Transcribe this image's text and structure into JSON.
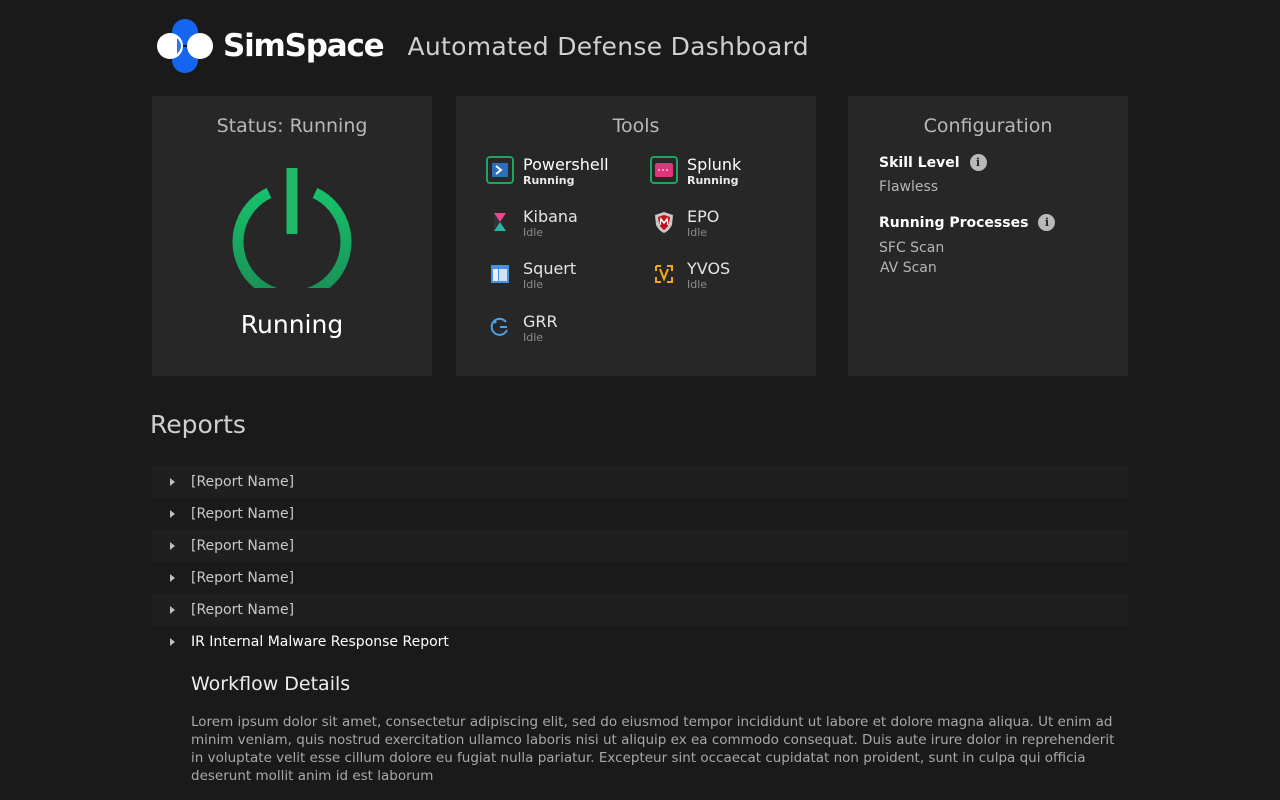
{
  "header": {
    "brand": "SimSpace",
    "title": "Automated Defense Dashboard"
  },
  "status": {
    "title": "Status: Running",
    "label": "Running",
    "color": "#1fa463"
  },
  "tools": {
    "title": "Tools",
    "items": [
      {
        "name": "Powershell",
        "state": "Running",
        "icon": "powershell-icon"
      },
      {
        "name": "Splunk",
        "state": "Running",
        "icon": "splunk-icon"
      },
      {
        "name": "Kibana",
        "state": "Idle",
        "icon": "kibana-icon"
      },
      {
        "name": "EPO",
        "state": "Idle",
        "icon": "mcafee-icon"
      },
      {
        "name": "Squert",
        "state": "Idle",
        "icon": "squert-icon"
      },
      {
        "name": "YVOS",
        "state": "Idle",
        "icon": "yvos-icon"
      },
      {
        "name": "GRR",
        "state": "Idle",
        "icon": "grr-icon"
      }
    ]
  },
  "config": {
    "title": "Configuration",
    "skill_label": "Skill Level",
    "skill_value": "Flawless",
    "processes_label": "Running Processes",
    "processes": [
      "SFC Scan",
      "AV Scan"
    ],
    "info_glyph": "i"
  },
  "reports": {
    "title": "Reports",
    "items": [
      "[Report Name]",
      "[Report Name]",
      "[Report Name]",
      "[Report Name]",
      "[Report Name]",
      "IR Internal Malware Response Report"
    ],
    "expanded": {
      "title": "Workflow Details",
      "body": "Lorem ipsum dolor sit amet, consectetur adipiscing elit, sed do eiusmod tempor incididunt ut labore et dolore magna aliqua. Ut enim ad minim veniam, quis nostrud exercitation ullamco laboris nisi ut aliquip ex ea commodo consequat. Duis aute irure dolor in reprehenderit in voluptate velit esse cillum dolore eu fugiat nulla pariatur. Excepteur sint occaecat cupidatat non proident, sunt in culpa qui officia deserunt mollit anim id est laborum"
    }
  },
  "colors": {
    "background": "#1a1a1b",
    "card": "#272727",
    "brand_blue": "#1565f0",
    "running_green": "#1fa463"
  }
}
